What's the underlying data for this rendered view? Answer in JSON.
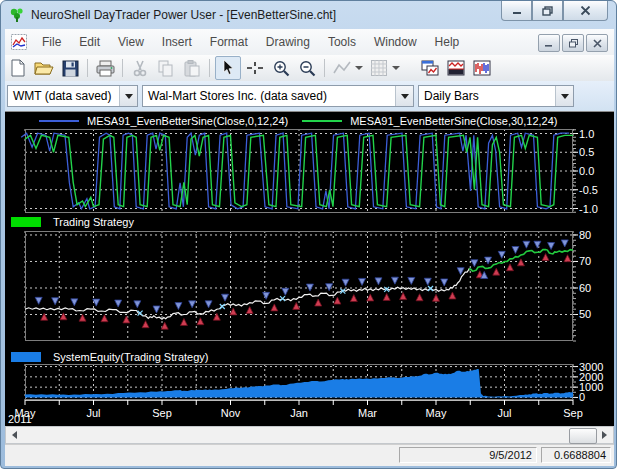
{
  "window": {
    "title": "NeuroShell DayTrader Power User - [EvenBetterSine.cht]",
    "icon": "neuroshell-logo",
    "caption_buttons": [
      "minimize",
      "restore",
      "close"
    ]
  },
  "menu": {
    "items": [
      "File",
      "Edit",
      "View",
      "Insert",
      "Format",
      "Drawing",
      "Tools",
      "Window",
      "Help"
    ],
    "mdi_buttons": [
      "minimize",
      "restore",
      "close"
    ]
  },
  "toolbar": {
    "buttons": [
      "new",
      "open",
      "save",
      "print",
      "cut",
      "copy",
      "paste",
      "pointer",
      "crosshair",
      "zoom-in",
      "zoom-out",
      "trendline",
      "pattern-fill",
      "chart-cascade",
      "chart-envelope",
      "chart-bars"
    ]
  },
  "selectors": {
    "symbol": "WMT (data saved)",
    "company": "Wal-Mart Stores Inc. (data saved)",
    "interval": "Daily Bars"
  },
  "statusbar": {
    "date": "9/5/2012",
    "value": "0.6688804"
  },
  "xaxis": {
    "year": "2011",
    "month_count": 17,
    "months": [
      {
        "text": "May",
        "i": 0
      },
      {
        "text": "Jul",
        "i": 2
      },
      {
        "text": "Sep",
        "i": 4
      },
      {
        "text": "Nov",
        "i": 6
      },
      {
        "text": "Jan",
        "i": 8
      },
      {
        "text": "Mar",
        "i": 10
      },
      {
        "text": "May",
        "i": 12
      },
      {
        "text": "Jul",
        "i": 14
      },
      {
        "text": "Sep",
        "i": 16
      }
    ]
  },
  "chart_data": [
    {
      "type": "line",
      "panel": "oscillator",
      "ylim": [
        -1.12,
        1.12
      ],
      "yticks": [
        {
          "v": 1,
          "label": "1.0"
        },
        {
          "v": 0.5,
          "label": "0.5"
        },
        {
          "v": 0,
          "label": "0.0"
        },
        {
          "v": -0.5,
          "label": "-0.5"
        },
        {
          "v": -1,
          "label": "-1.0"
        }
      ],
      "minor_step": 0.1,
      "vgrid_every": 2,
      "series": [
        {
          "name": "MESA91_EvenBetterSine(Close,0,12,24)",
          "color": "#3c5ed8",
          "dx": -0.7,
          "scale": 1.06
        },
        {
          "name": "MESA91_EvenBetterSine(Close,30,12,24)",
          "color": "#22d34b",
          "points": [
            [
              0,
              0.85
            ],
            [
              1,
              0.95
            ],
            [
              2,
              0.6
            ],
            [
              3,
              0.95
            ],
            [
              4.5,
              0.9
            ],
            [
              5.2,
              0.5
            ],
            [
              6,
              0.95
            ],
            [
              8,
              0.9
            ],
            [
              8.8,
              -0.3
            ],
            [
              9.5,
              -0.9
            ],
            [
              10.5,
              -0.8
            ],
            [
              11,
              -0.95
            ],
            [
              12,
              -0.7
            ],
            [
              12.5,
              -0.95
            ],
            [
              13.5,
              -0.9
            ],
            [
              14.3,
              0.85
            ],
            [
              15.5,
              0.95
            ],
            [
              16.2,
              0.9
            ],
            [
              17,
              -0.9
            ],
            [
              18,
              -0.95
            ],
            [
              18.6,
              0.9
            ],
            [
              19.6,
              0.95
            ],
            [
              20.3,
              0.9
            ],
            [
              21,
              -0.9
            ],
            [
              22.3,
              -0.95
            ],
            [
              23,
              0.9
            ],
            [
              24,
              0.95
            ],
            [
              24.6,
              0.55
            ],
            [
              25.3,
              0.95
            ],
            [
              26.3,
              0.9
            ],
            [
              27,
              -0.9
            ],
            [
              28.3,
              -0.95
            ],
            [
              29,
              -0.3
            ],
            [
              29.6,
              -0.9
            ],
            [
              30.3,
              0.85
            ],
            [
              31,
              0.95
            ],
            [
              31.8,
              0.4
            ],
            [
              32.5,
              0.9
            ],
            [
              33.5,
              0.95
            ],
            [
              34.2,
              -0.9
            ],
            [
              35.5,
              -0.95
            ],
            [
              36.3,
              0.9
            ],
            [
              37.5,
              0.95
            ],
            [
              38.3,
              -0.85
            ],
            [
              39.5,
              -0.95
            ],
            [
              40.5,
              -0.9
            ],
            [
              41.2,
              0.9
            ],
            [
              43.5,
              0.95
            ],
            [
              44.5,
              -0.9
            ],
            [
              45.8,
              -0.95
            ],
            [
              46.5,
              0.9
            ],
            [
              47.8,
              0.95
            ],
            [
              48.5,
              -0.9
            ],
            [
              50.5,
              -0.95
            ],
            [
              51.2,
              0.9
            ],
            [
              53,
              0.95
            ],
            [
              53.8,
              -0.9
            ],
            [
              55,
              -0.95
            ],
            [
              55.6,
              -0.5
            ],
            [
              56.2,
              -0.95
            ],
            [
              57,
              0.9
            ],
            [
              58.8,
              0.95
            ],
            [
              59.6,
              -0.9
            ],
            [
              61,
              -0.95
            ],
            [
              61.8,
              0.9
            ],
            [
              63.5,
              0.95
            ],
            [
              64.3,
              -0.9
            ],
            [
              66,
              -0.95
            ],
            [
              66.8,
              0.9
            ],
            [
              69.5,
              0.95
            ],
            [
              70.3,
              -0.9
            ],
            [
              72,
              -0.95
            ],
            [
              72.8,
              0.9
            ],
            [
              75,
              0.95
            ],
            [
              75.8,
              -0.9
            ],
            [
              76.6,
              -0.95
            ],
            [
              77.3,
              0.9
            ],
            [
              80,
              0.95
            ],
            [
              80.6,
              0.5
            ],
            [
              81.2,
              0.9
            ],
            [
              82,
              -0.5
            ],
            [
              82.6,
              0.9
            ],
            [
              83.4,
              -0.9
            ],
            [
              84.6,
              -0.95
            ],
            [
              85.3,
              0.7
            ],
            [
              86,
              0.9
            ],
            [
              86.6,
              0.5
            ],
            [
              87.3,
              -0.9
            ],
            [
              88.6,
              -0.95
            ],
            [
              89.3,
              0.9
            ],
            [
              90.6,
              0.95
            ],
            [
              91.3,
              0.6
            ],
            [
              92,
              0.95
            ],
            [
              93.5,
              0.9
            ],
            [
              94.2,
              -0.9
            ],
            [
              95.8,
              -0.95
            ],
            [
              96.5,
              -0.9
            ],
            [
              97.2,
              0.9
            ],
            [
              98.5,
              0.95
            ],
            [
              100,
              0.95
            ]
          ]
        }
      ]
    },
    {
      "type": "line",
      "panel": "price",
      "label": "Trading Strategy",
      "swatch": "#00dd00",
      "ylim": [
        40,
        81.5
      ],
      "yticks": [
        {
          "v": 80,
          "label": "80"
        },
        {
          "v": 70,
          "label": "70"
        },
        {
          "v": 60,
          "label": "60"
        },
        {
          "v": 50,
          "label": "50"
        }
      ],
      "minor_step": 2,
      "vgrid_every": 1,
      "price_color_before": "#f2f2f2",
      "price_color_after": "#22c93e",
      "green_from": 81,
      "points": [
        [
          0,
          52
        ],
        [
          2,
          52.5
        ],
        [
          4,
          51.8
        ],
        [
          6,
          52.3
        ],
        [
          8,
          52
        ],
        [
          10,
          51.5
        ],
        [
          12,
          52
        ],
        [
          14,
          51.3
        ],
        [
          16,
          51.8
        ],
        [
          18,
          50.8
        ],
        [
          20,
          51.5
        ],
        [
          21,
          50.5
        ],
        [
          22.5,
          48.5
        ],
        [
          23.5,
          49.5
        ],
        [
          25,
          48.2
        ],
        [
          26,
          49
        ],
        [
          27.5,
          50.5
        ],
        [
          29,
          50
        ],
        [
          30.5,
          51
        ],
        [
          32,
          50.3
        ],
        [
          33.5,
          51
        ],
        [
          35,
          52
        ],
        [
          36.5,
          53.5
        ],
        [
          38,
          54
        ],
        [
          39.5,
          53.2
        ],
        [
          41,
          54.5
        ],
        [
          42.5,
          55
        ],
        [
          44,
          54.2
        ],
        [
          45.5,
          55.5
        ],
        [
          47,
          56
        ],
        [
          48.5,
          55.2
        ],
        [
          50,
          56.5
        ],
        [
          51.5,
          57.5
        ],
        [
          53,
          57
        ],
        [
          54.5,
          58
        ],
        [
          56,
          57.2
        ],
        [
          57.5,
          58.5
        ],
        [
          59,
          59.5
        ],
        [
          60.5,
          58.8
        ],
        [
          62,
          59.8
        ],
        [
          63.5,
          59
        ],
        [
          65,
          60
        ],
        [
          66.5,
          59.2
        ],
        [
          68,
          60.3
        ],
        [
          69.5,
          59.5
        ],
        [
          71,
          60
        ],
        [
          72.5,
          59
        ],
        [
          74,
          59.8
        ],
        [
          75.5,
          58.8
        ],
        [
          77,
          59.5
        ],
        [
          78,
          60
        ],
        [
          79,
          62
        ],
        [
          80,
          65
        ],
        [
          81,
          67
        ],
        [
          82,
          66.5
        ],
        [
          83,
          68
        ],
        [
          84.5,
          67.5
        ],
        [
          86,
          69
        ],
        [
          87.5,
          70
        ],
        [
          89,
          71
        ],
        [
          90.5,
          72.5
        ],
        [
          92,
          74
        ],
        [
          93.5,
          73.5
        ],
        [
          95,
          74.5
        ],
        [
          96,
          73
        ],
        [
          97,
          73.5
        ],
        [
          98.5,
          74
        ],
        [
          100,
          74.2
        ]
      ],
      "buy_markers_x": [
        2.5,
        5.5,
        9,
        13,
        17,
        20.5,
        24,
        28,
        30.5,
        33.5,
        36.5,
        44,
        47.5,
        52,
        55.5,
        58.5,
        61.5,
        64.5,
        67.5,
        70.5,
        73.5,
        76.5,
        79.5,
        82,
        84.5,
        87,
        89.5,
        91.5,
        93.5,
        96,
        98.5
      ],
      "sell_markers_x": [
        3.5,
        7,
        10.5,
        14.5,
        18.5,
        22,
        25.5,
        29,
        32,
        35,
        38,
        41,
        45.5,
        49.5,
        53.5,
        57,
        60,
        63,
        66,
        69,
        72,
        75,
        78,
        83,
        86,
        88.5,
        90.5,
        95,
        99
      ],
      "buy_below_x": [
        83.8
      ],
      "exit_markers_x": [
        21,
        36,
        47,
        58,
        66,
        74
      ],
      "buy_color": "#8095d8",
      "buy_stroke": "#2b3f93",
      "sell_color": "#cf3d52",
      "sell_stroke": "#6e0f1e",
      "exit_color": "#86d8ff"
    },
    {
      "type": "area",
      "panel": "equity",
      "label": "SystemEquity(Trading Strategy)",
      "swatch": "#1a7de6",
      "ylim": [
        -250,
        3250
      ],
      "yticks": [
        {
          "v": 3000,
          "label": "3000"
        },
        {
          "v": 2000,
          "label": "2000"
        },
        {
          "v": 1000,
          "label": "1000"
        },
        {
          "v": 0,
          "label": "0"
        }
      ],
      "minor_step": 500,
      "vgrid_every": 1,
      "fill": "#1a7de6",
      "points": [
        [
          0,
          280
        ],
        [
          3,
          300
        ],
        [
          6,
          260
        ],
        [
          9,
          280
        ],
        [
          12,
          300
        ],
        [
          15,
          350
        ],
        [
          18,
          420
        ],
        [
          21,
          500
        ],
        [
          24,
          560
        ],
        [
          26,
          620
        ],
        [
          28,
          700
        ],
        [
          29,
          640
        ],
        [
          31,
          700
        ],
        [
          33,
          780
        ],
        [
          34,
          720
        ],
        [
          36,
          800
        ],
        [
          38,
          900
        ],
        [
          40,
          980
        ],
        [
          42,
          1050
        ],
        [
          44,
          1150
        ],
        [
          46,
          1250
        ],
        [
          47,
          1200
        ],
        [
          49,
          1350
        ],
        [
          51,
          1500
        ],
        [
          53,
          1600
        ],
        [
          54,
          1550
        ],
        [
          56,
          1700
        ],
        [
          58,
          1800
        ],
        [
          59,
          1750
        ],
        [
          61,
          1850
        ],
        [
          63,
          1800
        ],
        [
          65,
          1900
        ],
        [
          67,
          1950
        ],
        [
          68,
          1900
        ],
        [
          70,
          2000
        ],
        [
          72,
          2100
        ],
        [
          73,
          2300
        ],
        [
          74,
          2250
        ],
        [
          75,
          2400
        ],
        [
          76,
          2300
        ],
        [
          77,
          2250
        ],
        [
          78,
          2350
        ],
        [
          79,
          2600
        ],
        [
          80,
          2500
        ],
        [
          81,
          2550
        ],
        [
          82,
          2700
        ],
        [
          82.8,
          2750
        ],
        [
          83.2,
          400
        ],
        [
          83.6,
          150
        ],
        [
          85,
          100
        ],
        [
          87,
          80
        ],
        [
          89,
          150
        ],
        [
          91,
          250
        ],
        [
          92,
          300
        ],
        [
          93,
          380
        ],
        [
          94,
          350
        ],
        [
          95,
          420
        ],
        [
          96,
          380
        ],
        [
          97,
          450
        ],
        [
          98,
          400
        ],
        [
          99,
          480
        ],
        [
          100,
          520
        ]
      ]
    }
  ]
}
